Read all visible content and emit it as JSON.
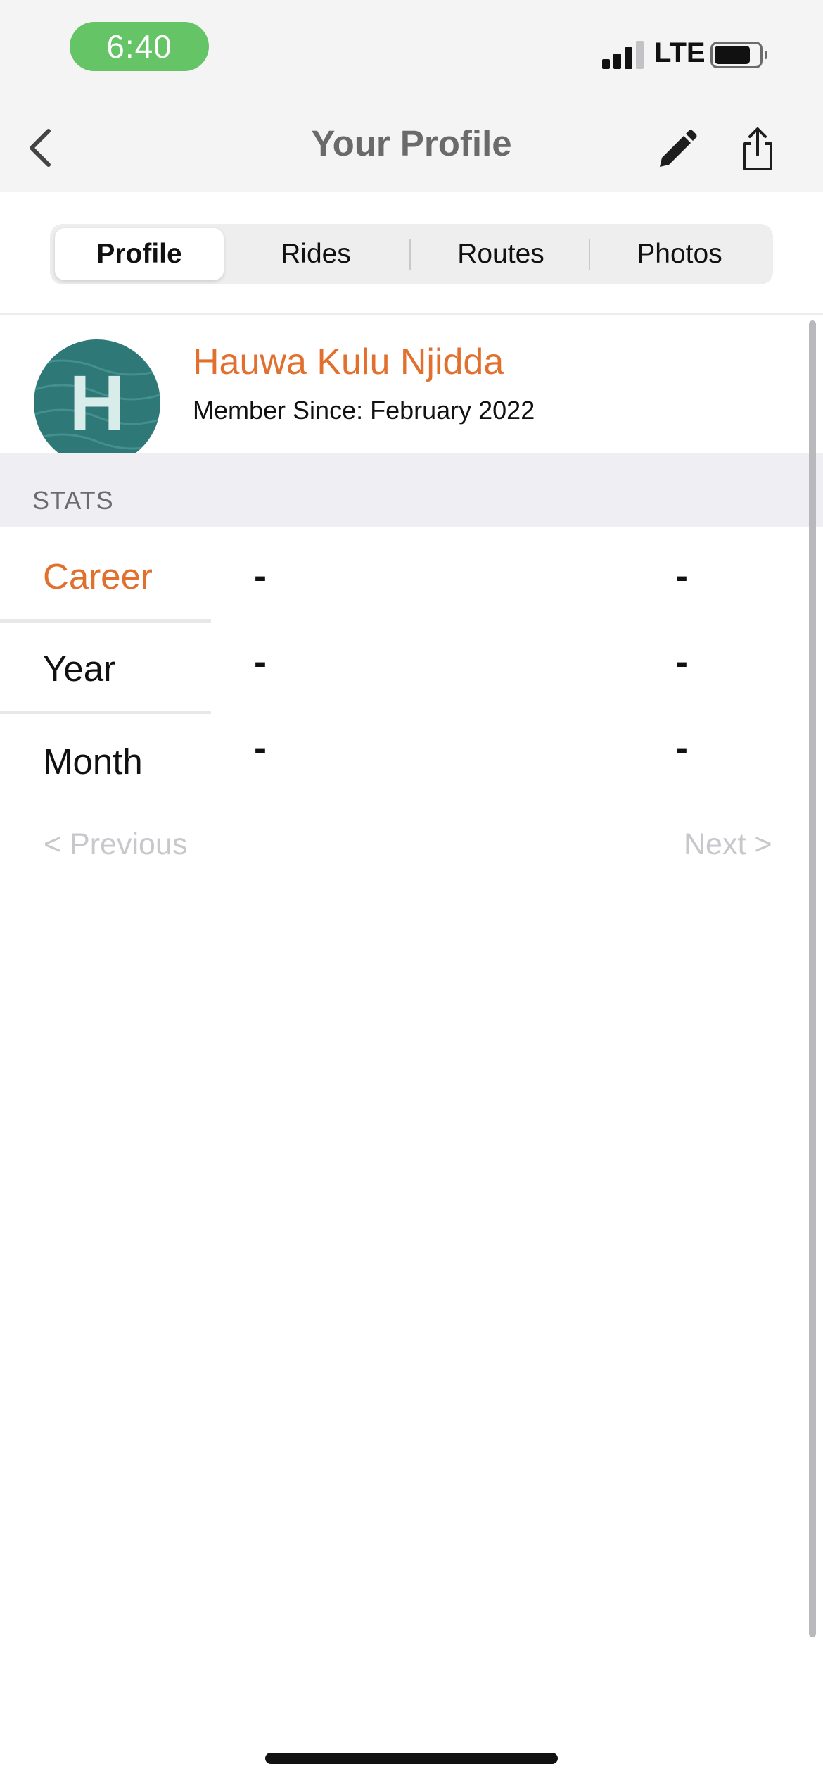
{
  "status_bar": {
    "time": "6:40",
    "network": "LTE",
    "battery_level": 0.8,
    "signal_bars": 3,
    "colors": {
      "time_pill": "#65c466"
    }
  },
  "nav": {
    "title": "Your Profile",
    "icons": {
      "back": "chevron-left-icon",
      "edit": "pencil-icon",
      "share": "share-icon"
    }
  },
  "tabs": {
    "selected": "Profile",
    "items": [
      {
        "label": "Profile"
      },
      {
        "label": "Rides"
      },
      {
        "label": "Routes"
      },
      {
        "label": "Photos"
      }
    ]
  },
  "profile": {
    "avatar_initial": "H",
    "name": "Hauwa Kulu Njidda",
    "member_since": "Member Since: February 2022",
    "colors": {
      "accent": "#e1702f",
      "avatar": "#2e7878"
    }
  },
  "stats": {
    "header": "STATS",
    "selected": "Career",
    "periods": [
      {
        "label": "Career",
        "values": [
          "-",
          "-"
        ]
      },
      {
        "label": "Year",
        "values": [
          "-",
          "-"
        ]
      },
      {
        "label": "Month",
        "values": [
          "-",
          "-"
        ]
      }
    ]
  },
  "pager": {
    "previous": "< Previous",
    "next": "Next >"
  }
}
